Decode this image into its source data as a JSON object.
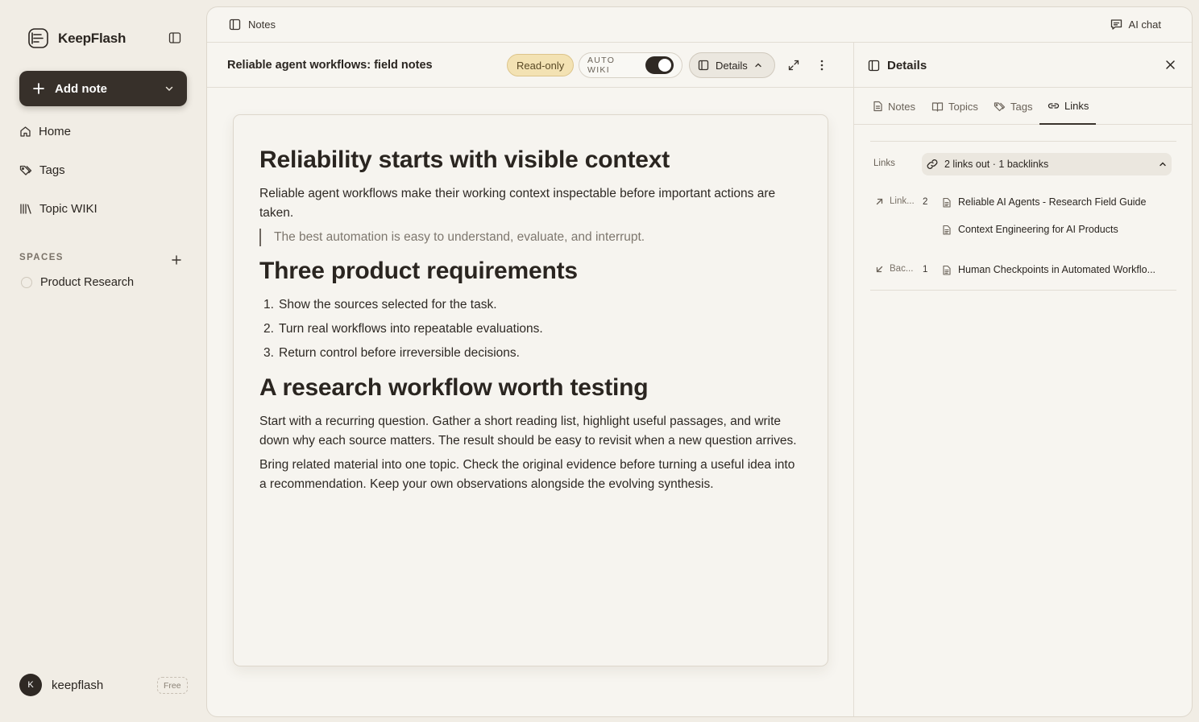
{
  "app": {
    "name": "KeepFlash"
  },
  "sidebar": {
    "add_note_label": "Add note",
    "nav": [
      {
        "label": "Home",
        "icon": "home-icon"
      },
      {
        "label": "Tags",
        "icon": "tag-icon"
      },
      {
        "label": "Topic WIKI",
        "icon": "library-icon"
      }
    ],
    "spaces_heading": "SPACES",
    "spaces": [
      {
        "label": "Product Research"
      }
    ],
    "user": {
      "initial": "K",
      "name": "keepflash",
      "plan": "Free"
    }
  },
  "topbar": {
    "breadcrumb": "Notes",
    "ai_chat_label": "AI chat"
  },
  "editor": {
    "title": "Reliable agent workflows: field notes",
    "readonly_label": "Read-only",
    "autowiki_label": "AUTO WIKI",
    "autowiki_on": true,
    "details_label": "Details"
  },
  "doc": {
    "h1_a": "Reliability starts with visible context",
    "p_a": "Reliable agent workflows make their working context inspectable before important actions are taken.",
    "quote": "The best automation is easy to understand, evaluate, and interrupt.",
    "h1_b": "Three product requirements",
    "list": [
      {
        "num": "1.",
        "text": "Show the sources selected for the task."
      },
      {
        "num": "2.",
        "text": "Turn real workflows into repeatable evaluations."
      },
      {
        "num": "3.",
        "text": "Return control before irreversible decisions."
      }
    ],
    "h1_c": "A research workflow worth testing",
    "p_c1": "Start with a recurring question. Gather a short reading list, highlight useful passages, and write down why each source matters. The result should be easy to revisit when a new question arrives.",
    "p_c2": "Bring related material into one topic. Check the original evidence before turning a useful idea into a recommendation. Keep your own observations alongside the evolving synthesis."
  },
  "details": {
    "title": "Details",
    "tabs": [
      {
        "label": "Notes",
        "icon": "note-icon"
      },
      {
        "label": "Topics",
        "icon": "book-icon"
      },
      {
        "label": "Tags",
        "icon": "tag-icon"
      },
      {
        "label": "Links",
        "icon": "link-icon",
        "active": true
      }
    ],
    "links": {
      "label": "Links",
      "summary": "2 links out · 1 backlinks",
      "outgoing": {
        "label": "Link...",
        "count": "2",
        "items": [
          "Reliable AI Agents - Research Field Guide",
          "Context Engineering for AI Products"
        ]
      },
      "backlinks": {
        "label": "Bac...",
        "count": "1",
        "items": [
          "Human Checkpoints in Automated Workflo..."
        ]
      }
    }
  },
  "colors": {
    "accent_dark": "#37302a",
    "readonly_bg": "#f3e2b3",
    "background": "#f1ede5"
  }
}
